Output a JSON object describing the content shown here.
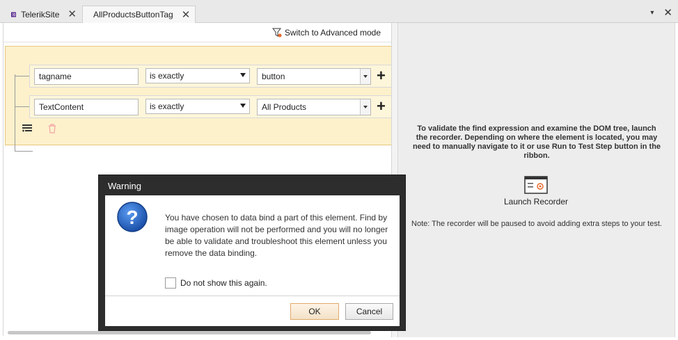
{
  "tabs": [
    {
      "label": "TelerikSite",
      "icon": "visual-studio-icon"
    },
    {
      "label": "AllProductsButtonTag",
      "icon": "element-tag-icon"
    }
  ],
  "toolbar": {
    "advanced_mode_label": "Switch to Advanced mode"
  },
  "find_rows": [
    {
      "attribute": "tagname",
      "operator": "is exactly",
      "value": "button"
    },
    {
      "attribute": "TextContent",
      "operator": "is exactly",
      "value": "All Products"
    }
  ],
  "right_pane": {
    "validate_text": "To validate the find expression and examine the DOM tree, launch the recorder. Depending on where the element is located, you may need to manually navigate to it or use Run to Test Step button in the ribbon.",
    "launch_label": "Launch Recorder",
    "note_text": "Note: The recorder will be paused to avoid adding extra steps to your test."
  },
  "dialog": {
    "title": "Warning",
    "message": "You have chosen to data bind a part of this element. Find by image operation will not be performed and you will no longer be able to validate and troubleshoot this element unless you remove the data binding.",
    "checkbox_label": "Do not show this again.",
    "ok_label": "OK",
    "cancel_label": "Cancel"
  },
  "colors": {
    "editor_bg": "#fdf1cc",
    "editor_border": "#e6c77a",
    "dialog_frame": "#2d2d2d",
    "question_icon": "#1f63c6"
  }
}
